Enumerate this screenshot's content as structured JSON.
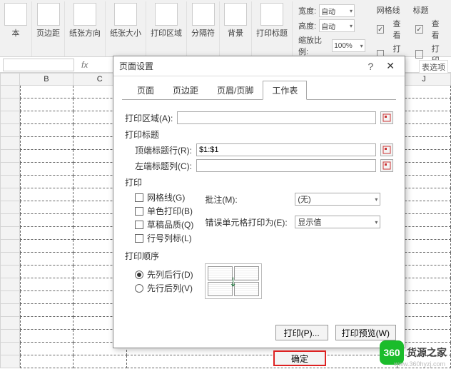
{
  "ribbon": {
    "groups": [
      {
        "label": "本"
      },
      {
        "label": "页边距"
      },
      {
        "label": "纸张方向"
      },
      {
        "label": "纸张大小"
      },
      {
        "label": "打印区域"
      },
      {
        "label": "分隔符"
      },
      {
        "label": "背景"
      },
      {
        "label": "打印标题"
      }
    ],
    "width_label": "宽度:",
    "height_label": "高度:",
    "scale_label": "缩放比例:",
    "auto": "自动",
    "scale_value": "100%",
    "gridlines_label": "网格线",
    "headings_label": "标题",
    "view_label": "查看",
    "print_label": "打印"
  },
  "sheet": {
    "columns": [
      "B",
      "C",
      "",
      "",
      "",
      "",
      "",
      "J"
    ]
  },
  "table_options": "表选项",
  "dialog": {
    "title": "页面设置",
    "tabs": [
      "页面",
      "页边距",
      "页眉/页脚",
      "工作表"
    ],
    "active_tab": 3,
    "print_area_label": "打印区域(A):",
    "print_area_value": "",
    "print_titles_label": "打印标题",
    "top_rows_label": "顶端标题行(R):",
    "top_rows_value": "$1:$1",
    "left_cols_label": "左端标题列(C):",
    "left_cols_value": "",
    "print_section": "打印",
    "gridlines": "网格线(G)",
    "bw": "单色打印(B)",
    "draft": "草稿品质(Q)",
    "rc_headings": "行号列标(L)",
    "comments_label": "批注(M):",
    "comments_value": "(无)",
    "errors_label": "错误单元格打印为(E):",
    "errors_value": "显示值",
    "order_label": "打印顺序",
    "down_over": "先列后行(D)",
    "over_down": "先行后列(V)",
    "btn_print": "打印(P)...",
    "btn_preview": "打印预览(W)",
    "btn_ok": "确定"
  },
  "watermark": {
    "logo": "360",
    "text": "货源之家",
    "url": "www.360hyzj.com"
  }
}
